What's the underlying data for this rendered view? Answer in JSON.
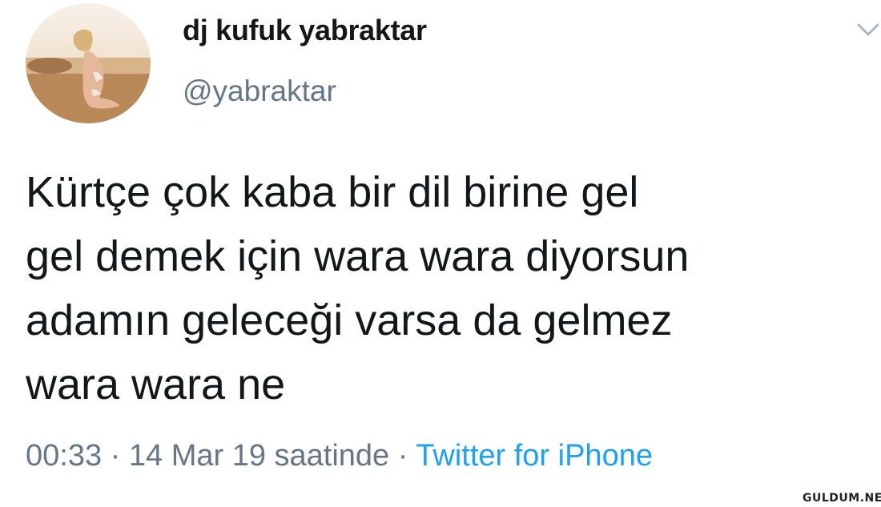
{
  "user": {
    "display_name": "dj kufuk yabraktar",
    "handle": "@yabraktar",
    "avatar_icon": "profile-photo"
  },
  "menu": {
    "icon": "chevron-down-icon"
  },
  "tweet": {
    "lines": [
      "Kürtçe çok kaba bir dil birine gel",
      "gel demek için wara wara diyorsun",
      "adamın geleceği varsa da gelmez",
      "wara wara ne"
    ]
  },
  "meta": {
    "timestamp": "00:33 · 14 Mar 19 saatinde ·",
    "source": "Twitter for iPhone"
  },
  "watermark": {
    "text": "GULDUM.NET"
  },
  "colors": {
    "text": "#14171a",
    "secondary": "#657786",
    "link": "#1da1f2"
  }
}
